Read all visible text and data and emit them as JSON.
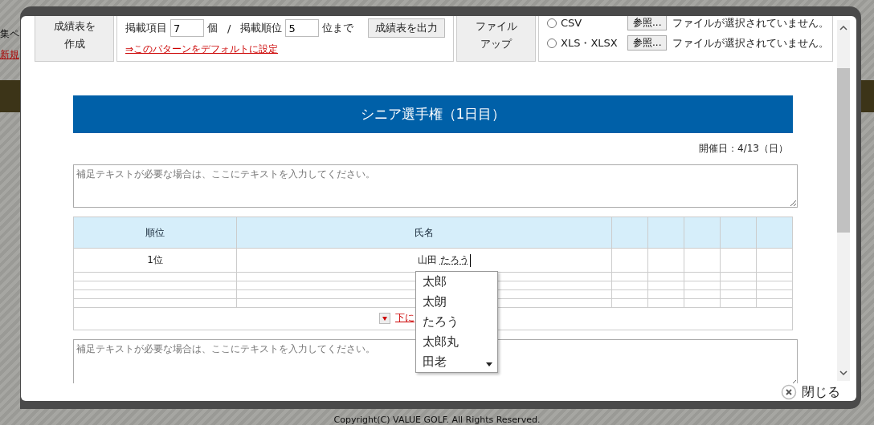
{
  "background_page": {
    "left_texts": [
      {
        "text": "集ペ",
        "kind": "plain"
      },
      {
        "text": "新規",
        "kind": "link"
      }
    ],
    "footer": "Copyright(C) VALUE GOLF. All Rights Reserved."
  },
  "toolbar": {
    "create_button": [
      "成績表を",
      "作成"
    ],
    "items_label": "掲載項目",
    "items_value": "7",
    "items_unit": "個",
    "separator": "/",
    "rank_label": "掲載順位",
    "rank_value": "5",
    "rank_unit": "位まで",
    "export_button": "成績表を出力",
    "default_link": "⇒このパターンをデフォルトに設定",
    "upload_button": [
      "ファイル",
      "アップ"
    ],
    "file_formats": [
      {
        "label": "CSV",
        "selected": false,
        "browse": "参照...",
        "status": "ファイルが選択されていません。"
      },
      {
        "label": "XLS・XLSX",
        "selected": false,
        "browse": "参照...",
        "status": "ファイルが選択されていません。"
      }
    ]
  },
  "title": "シニア選手権（1日目）",
  "date": "開催日：4/13（日）",
  "note_placeholder": "補足テキストが必要な場合は、ここにテキストを入力してください。",
  "table": {
    "columns": [
      "順位",
      "氏名"
    ],
    "rows": [
      {
        "rank": "1位",
        "name": "山田",
        "composing": "たろう"
      }
    ],
    "add_row_link": "下に",
    "candidates": [
      "太郎",
      "太朗",
      "たろう",
      "太郎丸",
      "田老"
    ]
  },
  "note2_placeholder": "補足テキストが必要な場合は、ここにテキストを入力してください。",
  "close_button": "閉じる"
}
